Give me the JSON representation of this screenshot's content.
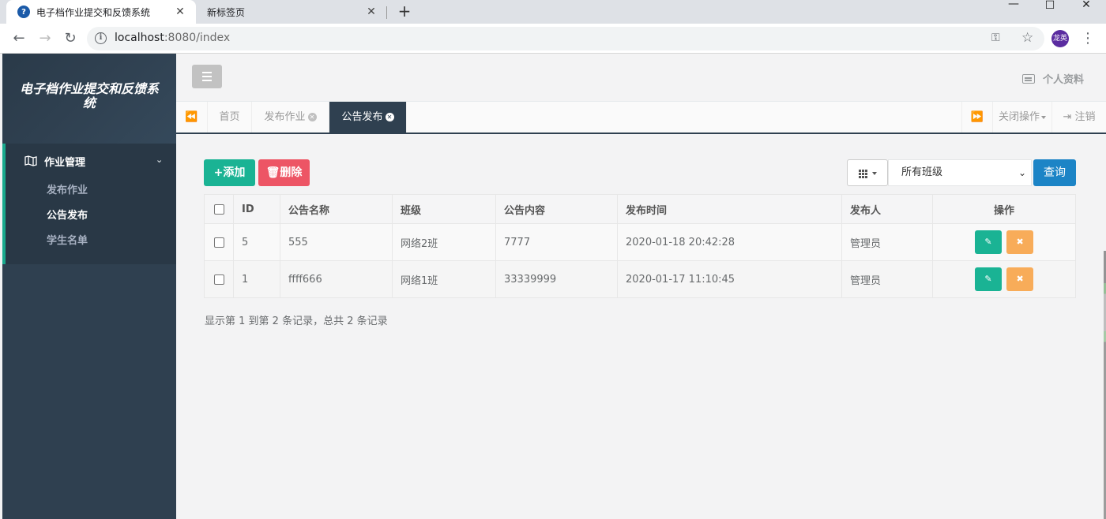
{
  "browser": {
    "tabs": [
      {
        "title": "电子档作业提交和反馈系统",
        "active": true
      },
      {
        "title": "新标签页",
        "active": false
      }
    ],
    "new_tab": "+",
    "window_controls": {
      "minimize": "—",
      "maximize": "☐",
      "close": "✕"
    },
    "url_host": "localhost",
    "url_rest": ":8080/index",
    "profile": "龙英"
  },
  "sidebar": {
    "title": "电子档作业提交和反馈系统",
    "group": {
      "label": "作业管理",
      "items": [
        {
          "label": "发布作业",
          "active": false
        },
        {
          "label": "公告发布",
          "active": true
        },
        {
          "label": "学生名单",
          "active": false
        }
      ]
    }
  },
  "topnav": {
    "profile_label": "个人资料"
  },
  "content_tabs": {
    "home": "首页",
    "tabs": [
      {
        "label": "发布作业",
        "active": false
      },
      {
        "label": "公告发布",
        "active": true
      }
    ],
    "close_ops": "关闭操作",
    "logout": "注销"
  },
  "toolbar": {
    "add_label": "+添加",
    "delete_label": "删除",
    "class_select": {
      "selected": "所有班级"
    },
    "query_label": "查询"
  },
  "table": {
    "columns": [
      "ID",
      "公告名称",
      "班级",
      "公告内容",
      "发布时间",
      "发布人",
      "操作"
    ],
    "rows": [
      {
        "id": "5",
        "name": "555",
        "class": "网络2班",
        "content": "7777",
        "time": "2020-01-18 20:42:28",
        "publisher": "管理员"
      },
      {
        "id": "1",
        "name": "ffff666",
        "class": "网络1班",
        "content": "33339999",
        "time": "2020-01-17 11:10:45",
        "publisher": "管理员"
      }
    ]
  },
  "pagination": {
    "summary": "显示第 1 到第 2 条记录，总共 2 条记录"
  },
  "colors": {
    "sidebar_bg": "#2f4050",
    "accent_green": "#1ab394",
    "danger_red": "#ed5565",
    "warning_orange": "#f8ac59",
    "primary_blue": "#1c84c6"
  }
}
